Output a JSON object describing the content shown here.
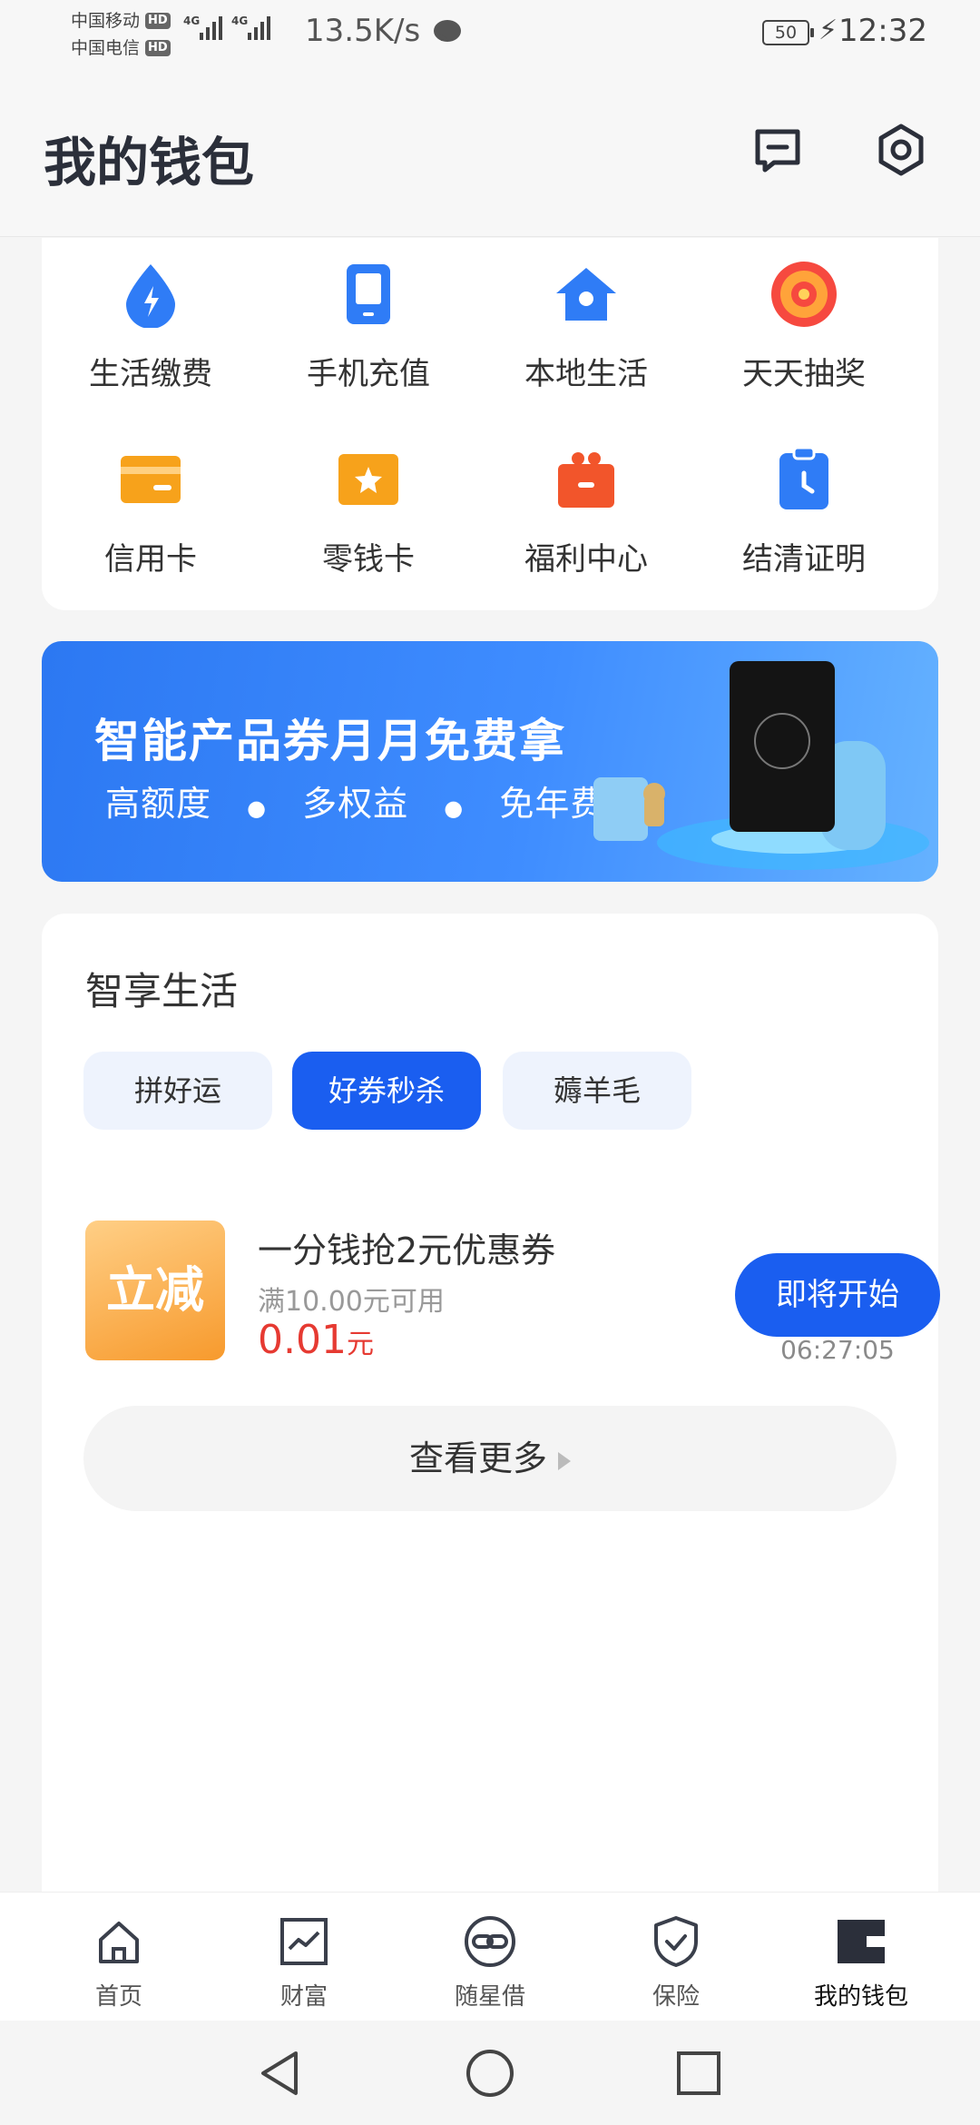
{
  "status_bar": {
    "carriers": [
      "中国移动",
      "中国电信"
    ],
    "hd_badge": "HD",
    "network_tags": [
      "4G",
      "4G"
    ],
    "net_speed": "13.5K/s",
    "battery": "50",
    "time": "12:32"
  },
  "header": {
    "title": "我的钱包",
    "message_icon": "message-icon",
    "settings_icon": "settings-icon"
  },
  "shortcuts": [
    {
      "label": "生活缴费",
      "icon": "water-drop-icon",
      "color": "#2f7cf6"
    },
    {
      "label": "手机充值",
      "icon": "phone-icon",
      "color": "#2f7cf6"
    },
    {
      "label": "本地生活",
      "icon": "home-location-icon",
      "color": "#2f7cf6"
    },
    {
      "label": "天天抽奖",
      "icon": "lucky-wheel-icon",
      "color": "#f6493f"
    },
    {
      "label": "信用卡",
      "icon": "credit-card-icon",
      "color": "#f7a21b"
    },
    {
      "label": "零钱卡",
      "icon": "star-card-icon",
      "color": "#f7a21b"
    },
    {
      "label": "福利中心",
      "icon": "gift-box-icon",
      "color": "#f2552b"
    },
    {
      "label": "结清证明",
      "icon": "clipboard-clock-icon",
      "color": "#2f7cf6"
    }
  ],
  "banner": {
    "title": "智能产品券月月免费拿",
    "subtitle_items": [
      "高额度",
      "多权益",
      "免年费"
    ]
  },
  "life": {
    "title": "智享生活",
    "tabs": [
      {
        "label": "拼好运",
        "active": false
      },
      {
        "label": "好券秒杀",
        "active": true
      },
      {
        "label": "薅羊毛",
        "active": false
      }
    ],
    "deal": {
      "thumb_text": "立减",
      "title": "一分钱抢2元优惠券",
      "condition": "满10.00元可用",
      "price": "0.01",
      "price_unit": "元",
      "button": "即将开始",
      "countdown": "06:27:05"
    },
    "more": "查看更多"
  },
  "bottom_nav": [
    {
      "label": "首页",
      "icon": "home-icon",
      "active": false
    },
    {
      "label": "财富",
      "icon": "chart-icon",
      "active": false
    },
    {
      "label": "随星借",
      "icon": "link-circle-icon",
      "active": false
    },
    {
      "label": "保险",
      "icon": "shield-icon",
      "active": false
    },
    {
      "label": "我的钱包",
      "icon": "wallet-icon",
      "active": true
    }
  ],
  "colors": {
    "accent": "#1a5ef0",
    "price": "#e63a32",
    "tab_bg": "#eef3fd"
  }
}
